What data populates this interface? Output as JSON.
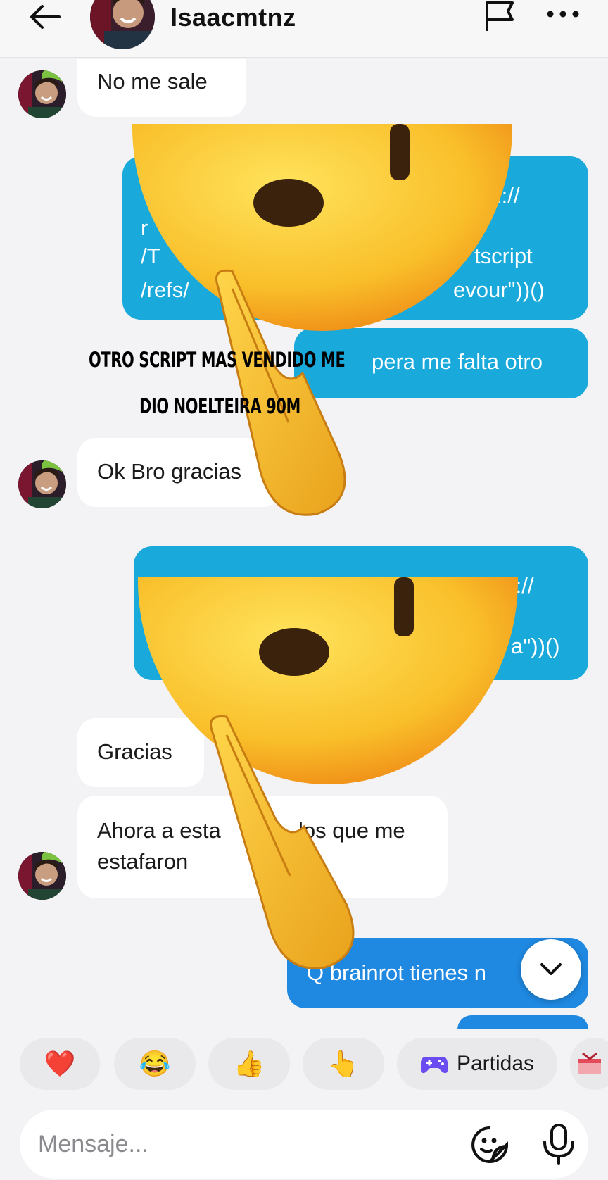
{
  "header": {
    "username": "Isaacmtnz"
  },
  "messages": {
    "m1": "No me sale",
    "m2_l1": ":://",
    "m2_l2": "r",
    "m2_l3a": "/T",
    "m2_l3b": "tscript",
    "m2_l4a": "/refs/",
    "m2_l4b": "evour\"))()",
    "m3": "pera me falta otro",
    "m4": "Ok Bro gracias",
    "m5_l1": ":://",
    "m5_l2": "a\"))()",
    "m6": "Gracias",
    "m7_l1a": "Ahora a esta",
    "m7_l1b": "los que me",
    "m7_l2": "estafaron",
    "m8": "Q brainrot tienes n"
  },
  "overlay": {
    "line1": "OTRO SCRIPT MAS VENDIDO ME",
    "line2": "DIO NOELTEIRA 90M"
  },
  "quick_replies": {
    "heart": "❤️",
    "laugh": "😂",
    "thumbs": "👍",
    "point": "👆",
    "games_label": "Partidas"
  },
  "composer": {
    "placeholder": "Mensaje..."
  },
  "colors": {
    "cyan_bubble": "#1aa9db",
    "blue_bubble": "#1f88e0",
    "incoming_bubble": "#ffffff"
  },
  "icons": [
    "back-arrow-icon",
    "flag-icon",
    "more-icon",
    "chevron-down-icon",
    "game-controller-icon",
    "sticker-icon",
    "microphone-icon"
  ]
}
